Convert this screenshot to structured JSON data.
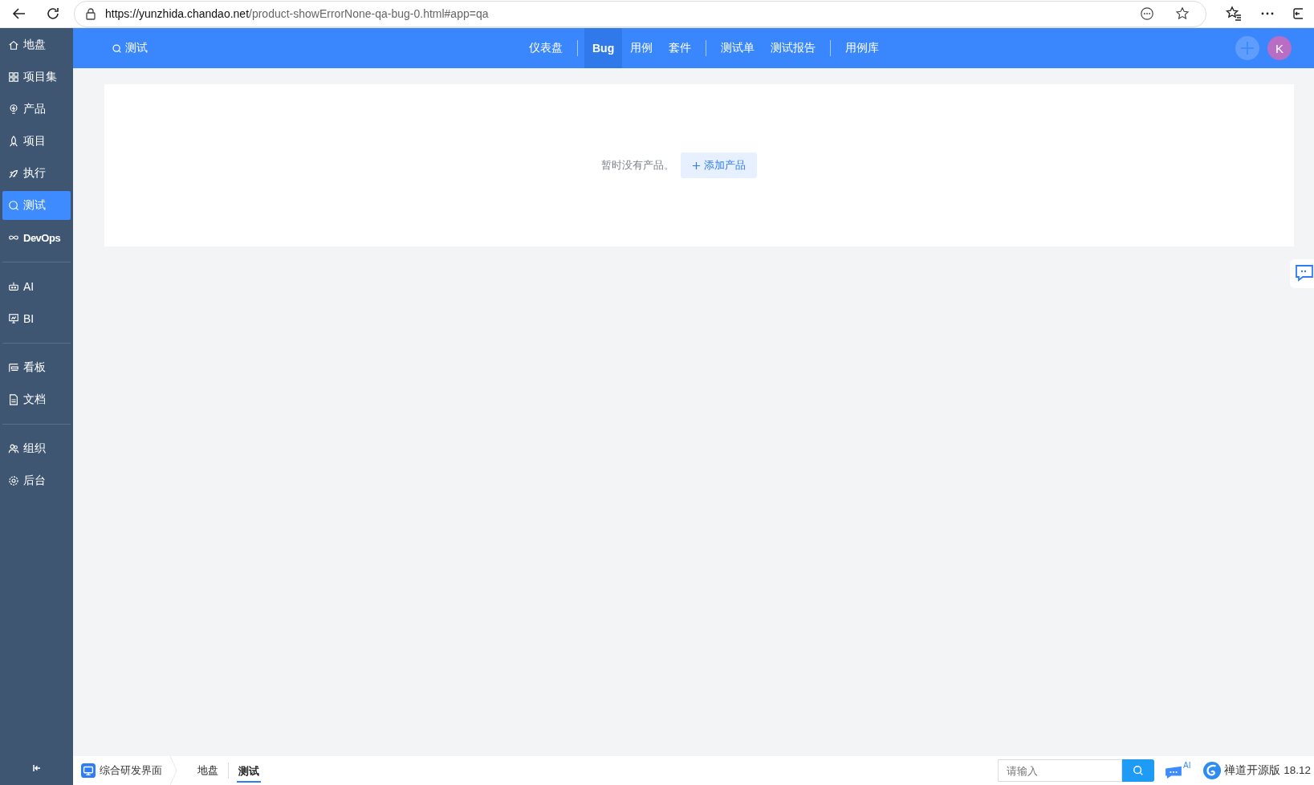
{
  "browser": {
    "url_host": "https://yunzhida.chandao.net",
    "url_path": "/product-showErrorNone-qa-bug-0.html#app=qa"
  },
  "sidebar": {
    "groups": [
      [
        {
          "label": "地盘",
          "selected": false
        },
        {
          "label": "项目集",
          "selected": false
        },
        {
          "label": "产品",
          "selected": false
        },
        {
          "label": "项目",
          "selected": false
        },
        {
          "label": "执行",
          "selected": false
        },
        {
          "label": "测试",
          "selected": true
        },
        {
          "label": "DevOps",
          "selected": false
        }
      ],
      [
        {
          "label": "AI",
          "selected": false
        },
        {
          "label": "BI",
          "selected": false
        }
      ],
      [
        {
          "label": "看板",
          "selected": false
        },
        {
          "label": "文档",
          "selected": false
        }
      ],
      [
        {
          "label": "组织",
          "selected": false
        },
        {
          "label": "后台",
          "selected": false
        }
      ]
    ]
  },
  "header": {
    "title": "测试",
    "avatar": "K",
    "nav": [
      {
        "label": "仪表盘",
        "selected": false,
        "separator_before": false
      },
      {
        "label": "Bug",
        "selected": true,
        "separator_before": true
      },
      {
        "label": "用例",
        "selected": false,
        "separator_before": false
      },
      {
        "label": "套件",
        "selected": false,
        "separator_before": false
      },
      {
        "label": "测试单",
        "selected": false,
        "separator_before": true
      },
      {
        "label": "测试报告",
        "selected": false,
        "separator_before": false
      },
      {
        "label": "用例库",
        "selected": false,
        "separator_before": true
      }
    ]
  },
  "empty": {
    "message": "暂时没有产品。",
    "action": "添加产品"
  },
  "footer": {
    "app": "综合研发界面",
    "crumbs": [
      {
        "label": "地盘",
        "selected": false
      },
      {
        "label": "测试",
        "selected": true
      }
    ],
    "search": {
      "placeholder": "请输入"
    },
    "ai_badge": "AI",
    "version": "禅道开源版 18.12"
  }
}
